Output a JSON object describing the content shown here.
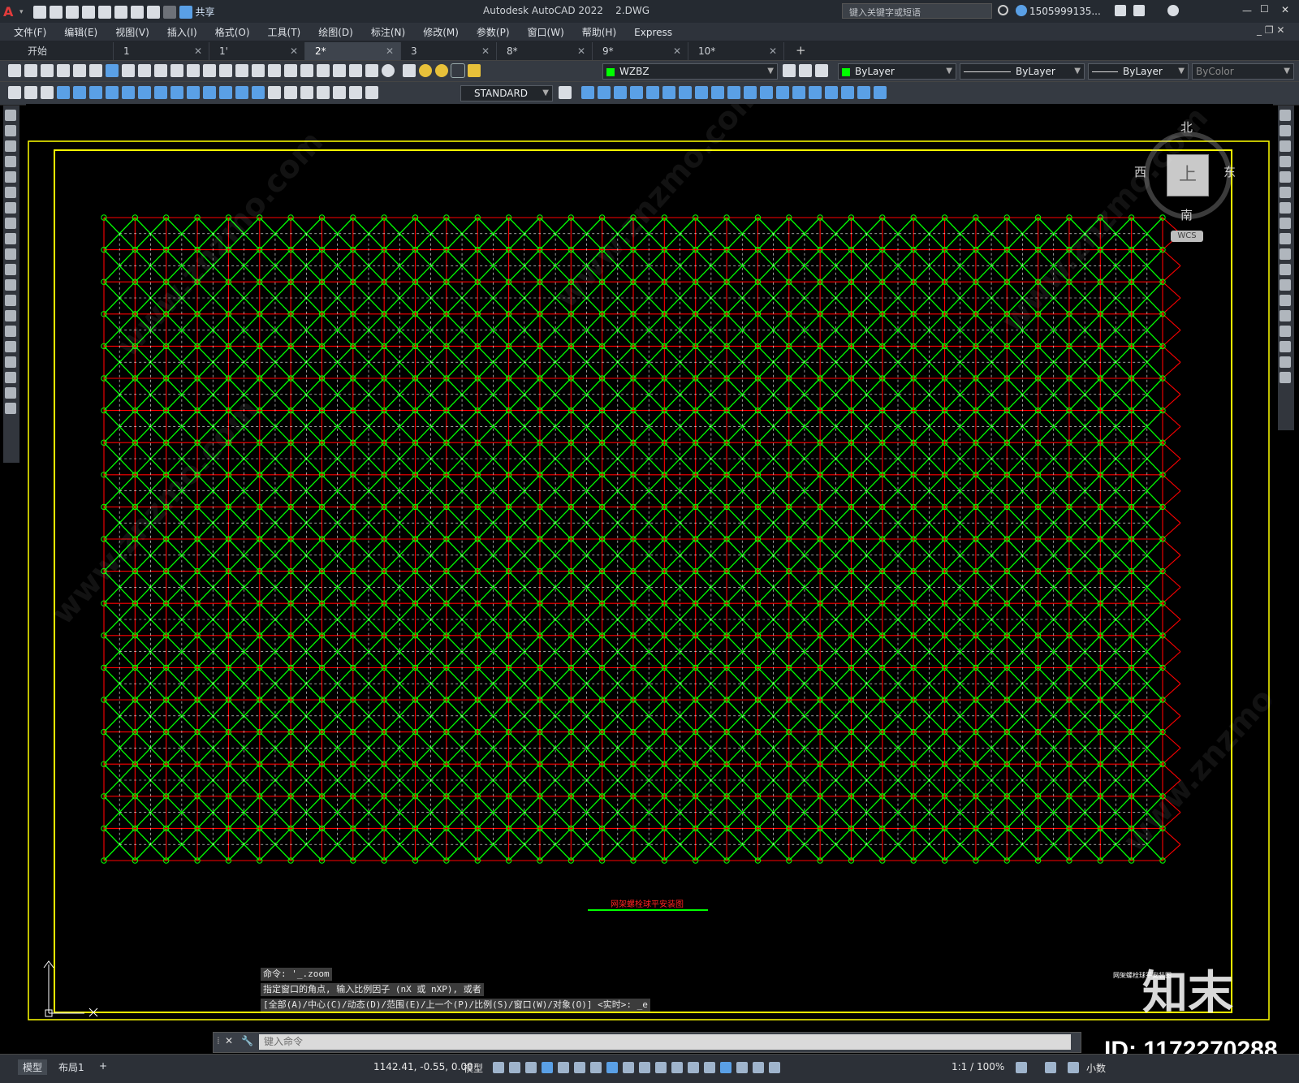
{
  "app": {
    "title": "Autodesk AutoCAD 2022    2.DWG",
    "share": "共享",
    "search_placeholder": "键入关键字或短语",
    "user": "1505999135...",
    "window_controls": [
      "—",
      "☐",
      "✕"
    ]
  },
  "menu": [
    "文件(F)",
    "编辑(E)",
    "视图(V)",
    "插入(I)",
    "格式(O)",
    "工具(T)",
    "绘图(D)",
    "标注(N)",
    "修改(M)",
    "参数(P)",
    "窗口(W)",
    "帮助(H)",
    "Express"
  ],
  "tabs": [
    {
      "label": "开始",
      "closable": false
    },
    {
      "label": "1",
      "closable": true
    },
    {
      "label": "1'",
      "closable": true
    },
    {
      "label": "2*",
      "closable": true,
      "active": true
    },
    {
      "label": "3",
      "closable": true
    },
    {
      "label": "8*",
      "closable": true
    },
    {
      "label": "9*",
      "closable": true
    },
    {
      "label": "10*",
      "closable": true
    }
  ],
  "toolbar": {
    "layer": "WZBZ",
    "color": "ByLayer",
    "linetype": "ByLayer",
    "lineweight": "ByLayer",
    "plotstyle": "ByColor",
    "textstyle": "STANDARD"
  },
  "viewcube": {
    "north": "北",
    "south": "南",
    "east": "东",
    "west": "西",
    "top": "上",
    "ucs": "WCS"
  },
  "drawing": {
    "title_text": "网架螺栓球平安装图",
    "stamp_text": "网架螺栓球平安装图",
    "colors": {
      "border": "#ffff00",
      "red_lines": "#ff0000",
      "green_members": "#00ff00",
      "dashed": "#ffffff"
    }
  },
  "command": {
    "history": [
      "命令: '_.zoom",
      "指定窗口的角点, 输入比例因子 (nX 或 nXP), 或者",
      "[全部(A)/中心(C)/动态(D)/范围(E)/上一个(P)/比例(S)/窗口(W)/对象(O)] <实时>: _e"
    ],
    "placeholder": "键入命令"
  },
  "status": {
    "tab_model": "模型",
    "tab_layout": "布局1",
    "add": "+",
    "coords": "1142.41, -0.55, 0.00",
    "space": "模型",
    "scale": "1:1 / 100%",
    "units": "小数"
  },
  "watermark": {
    "id_text": "ID: 1172270288",
    "brand": "知末",
    "site": "www.znzmo.com"
  }
}
